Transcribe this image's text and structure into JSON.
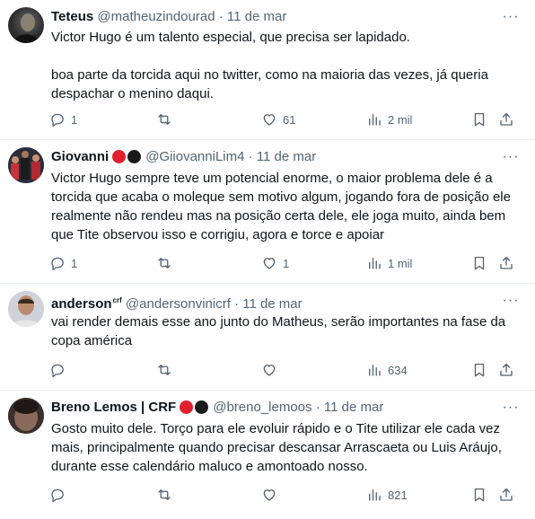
{
  "colors": {
    "red_badge": "#e0202d",
    "black_badge": "#1a1a1a",
    "muted": "#536471"
  },
  "tweets": [
    {
      "name": "Teteus",
      "handle": "@matheuzindourad",
      "date": "11 de mar",
      "text_lines": [
        "Victor Hugo é um talento especial, que precisa ser lapidado.",
        "boa parte da torcida aqui no twitter, como na maioria das vezes, já queria despachar o menino daqui."
      ],
      "replies": "1",
      "retweets": "",
      "likes": "61",
      "views": "2 mil"
    },
    {
      "name": "Giovanni",
      "handle": "@GiiovanniLim4",
      "date": "11 de mar",
      "badges": [
        "red",
        "black"
      ],
      "text_lines": [
        "Victor Hugo sempre teve um potencial enorme, o maior problema dele é a torcida que acaba o moleque sem motivo algum, jogando fora de posição ele realmente não rendeu mas na posição certa dele, ele joga muito, ainda bem que Tite observou isso e corrigiu, agora e torce e apoiar"
      ],
      "replies": "1",
      "retweets": "",
      "likes": "1",
      "views": "1 mil"
    },
    {
      "name": "anderson",
      "name_sup": "crf",
      "handle": "@andersonvinicrf",
      "date": "11 de mar",
      "text_lines": [
        "vai render demais esse ano junto do Matheus, serão importantes na fase da copa américa"
      ],
      "replies": "",
      "retweets": "",
      "likes": "",
      "views": "634"
    },
    {
      "name": "Breno Lemos | CRF",
      "handle": "@breno_lemoos",
      "date": "11 de mar",
      "badges": [
        "red",
        "black"
      ],
      "text_lines": [
        "Gosto muito dele. Torço para ele evoluir rápido e o Tite utilizar ele cada vez mais, principalmente quando precisar descansar Arrascaeta ou Luis Aráujo, durante esse calendário maluco e amontoado nosso."
      ],
      "replies": "",
      "retweets": "",
      "likes": "",
      "views": "821"
    }
  ],
  "icons": {
    "reply": "reply-icon",
    "retweet": "retweet-icon",
    "like": "heart-icon",
    "views": "views-chart-icon",
    "bookmark": "bookmark-icon",
    "share": "share-icon",
    "more": "more-options-icon"
  }
}
